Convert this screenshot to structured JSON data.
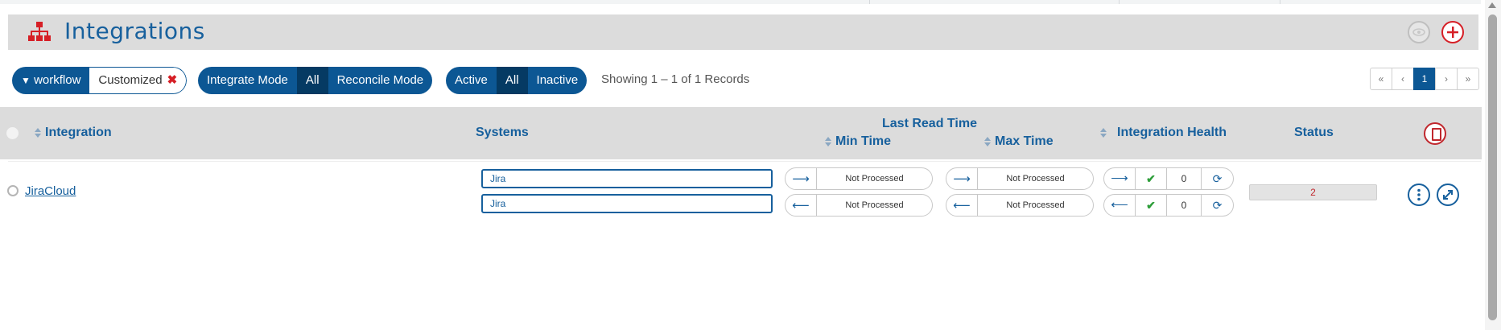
{
  "header": {
    "title": "Integrations",
    "accent_color": "#17609d",
    "icon_color": "#d61f26"
  },
  "filters": {
    "workflow_label": "workflow",
    "workflow_value": "Customized",
    "mode": {
      "integrate": "Integrate Mode",
      "all": "All",
      "reconcile": "Reconcile Mode",
      "selected": "All"
    },
    "state": {
      "active": "Active",
      "all": "All",
      "inactive": "Inactive",
      "selected": "All"
    },
    "records_text": "Showing 1 – 1 of 1 Records"
  },
  "pagination": {
    "first": "«",
    "prev": "‹",
    "current": "1",
    "next": "›",
    "last": "»"
  },
  "table": {
    "columns": {
      "integration": "Integration",
      "systems": "Systems",
      "last_read_time": "Last Read Time",
      "min_time": "Min Time",
      "max_time": "Max Time",
      "integration_health": "Integration Health",
      "status": "Status"
    },
    "rows": [
      {
        "name": "JiraCloud",
        "systems": [
          "Jira",
          "Jira"
        ],
        "min_time": [
          "Not Processed",
          "Not Processed"
        ],
        "max_time": [
          "Not Processed",
          "Not Processed"
        ],
        "health_counts": [
          "0",
          "0"
        ],
        "status": "2"
      }
    ]
  },
  "glyphs": {
    "arrow_right": "⟶",
    "arrow_left": "⟵",
    "check": "✔",
    "refresh": "⟳"
  },
  "icons": [
    "sitemap-icon",
    "eye-icon",
    "plus-circle-icon",
    "filter-icon",
    "close-icon",
    "sort-icon",
    "export-icon",
    "more-vertical-icon",
    "expand-icon"
  ]
}
